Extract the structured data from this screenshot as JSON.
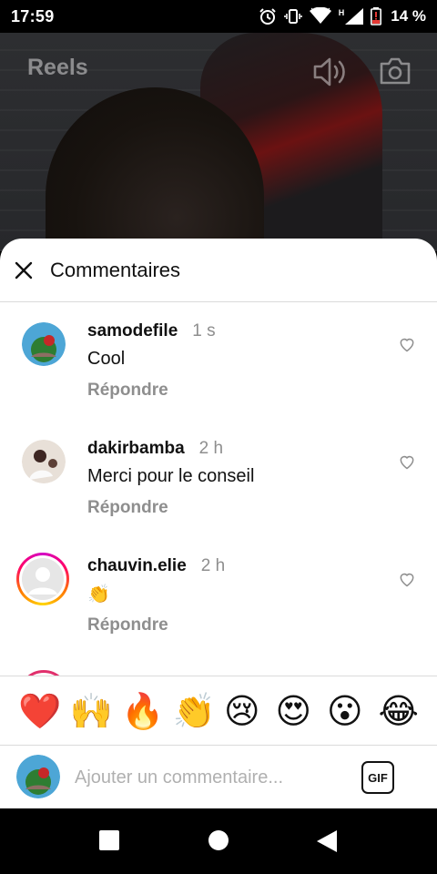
{
  "status_bar": {
    "time": "17:59",
    "battery": "14 %",
    "network": "H"
  },
  "reels": {
    "title": "Reels"
  },
  "comments_sheet": {
    "title": "Commentaires",
    "comments": [
      {
        "username": "samodefile",
        "time": "1 s",
        "text": "Cool",
        "reply_label": "Répondre"
      },
      {
        "username": "dakirbamba",
        "time": "2 h",
        "text": "Merci pour le conseil",
        "reply_label": "Répondre"
      },
      {
        "username": "chauvin.elie",
        "time": "2 h",
        "text": "👏",
        "reply_label": "Répondre"
      }
    ],
    "emoji_reactions": [
      "❤️",
      "🙌",
      "🔥",
      "👏",
      "😢",
      "😍",
      "😮",
      "😂"
    ],
    "input": {
      "placeholder": "Ajouter un commentaire...",
      "gif_label": "GIF"
    }
  },
  "colors": {
    "accent_story_ring": "#e1306c",
    "secondary_text": "#8e8e8e",
    "divider": "#dbdbdb"
  }
}
